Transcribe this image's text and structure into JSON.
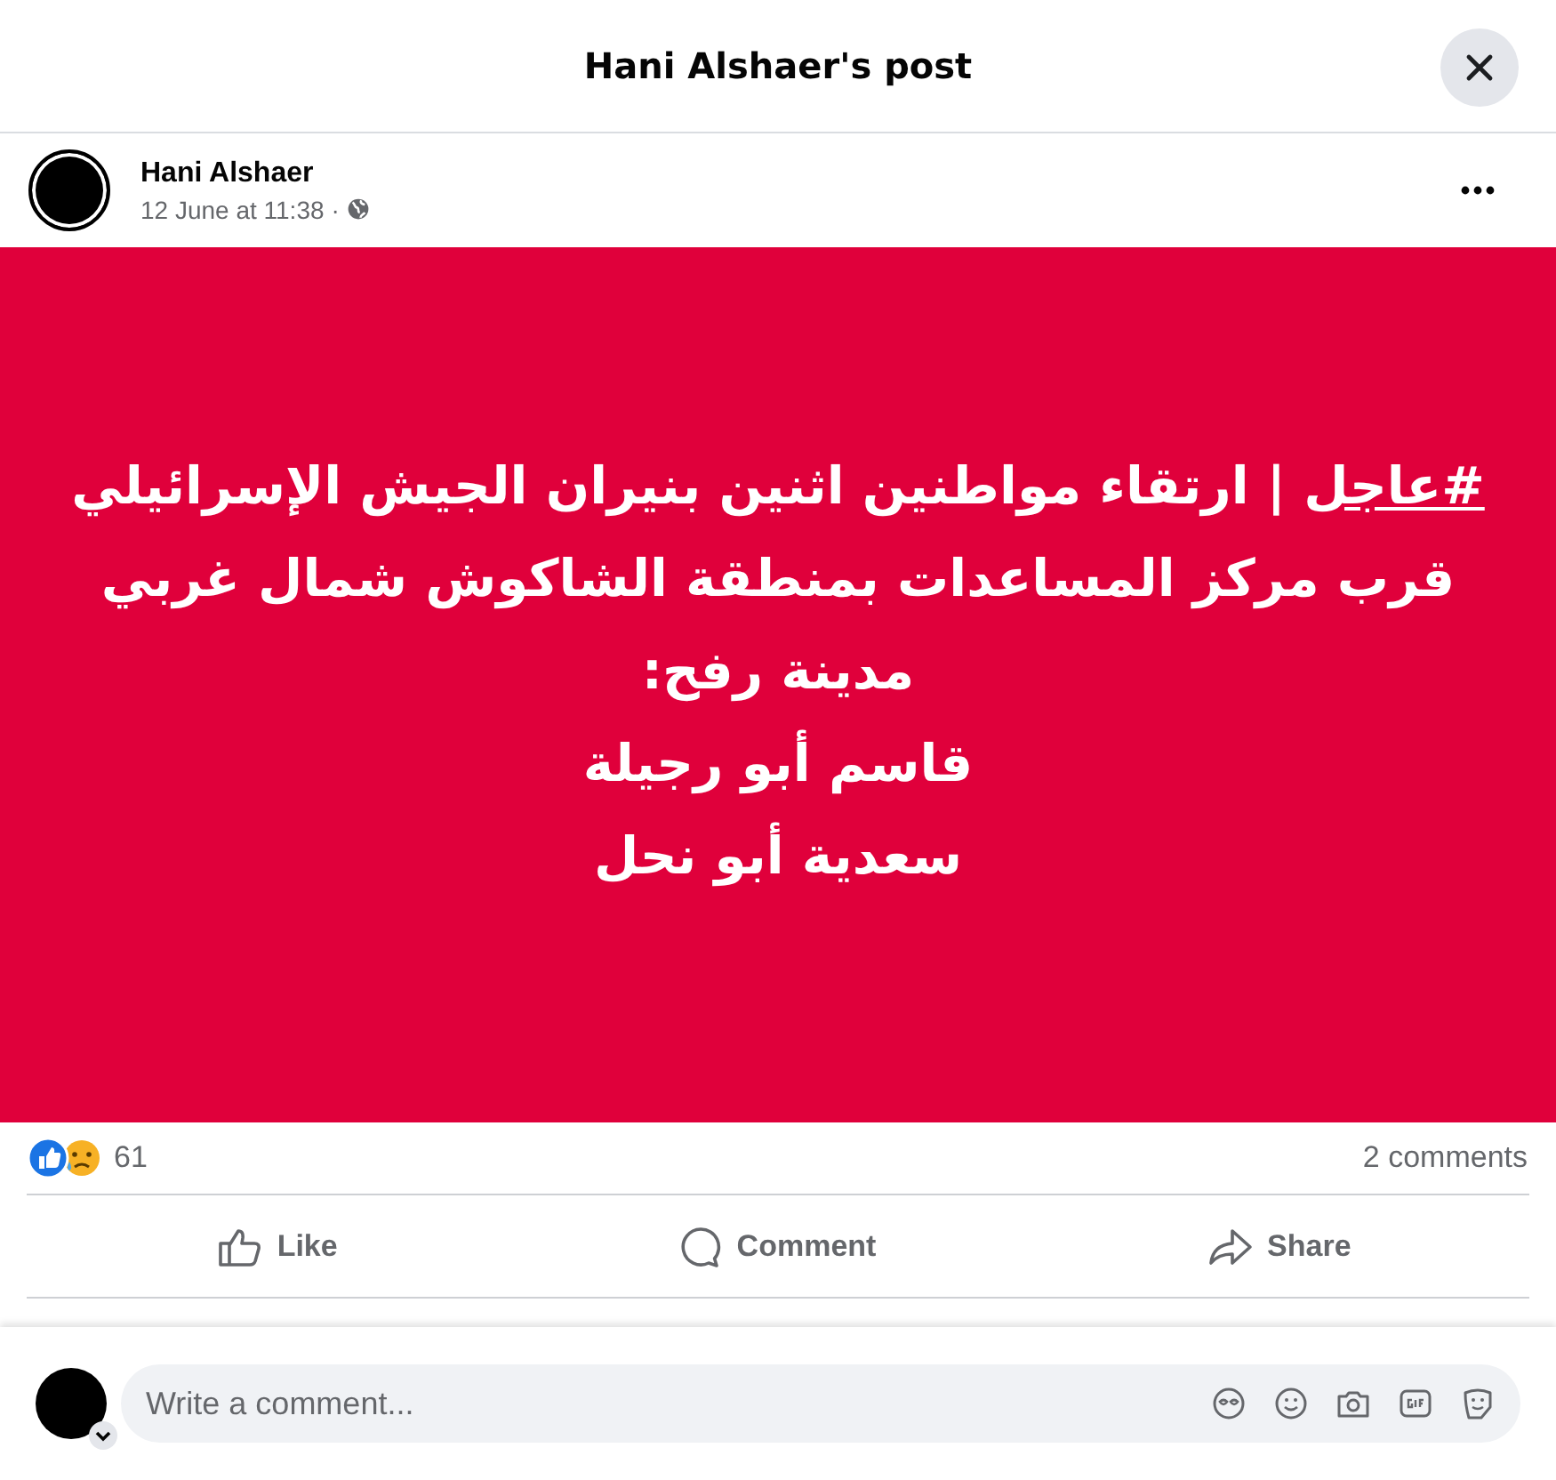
{
  "dialog": {
    "title": "Hani Alshaer's post"
  },
  "post": {
    "author": "Hani Alshaer",
    "time": "12 June at 11:38",
    "separator": "·",
    "hashtag": "#عاجل",
    "text": "| ارتقاء مواطنين اثنين بنيران الجيش الإسرائيلي قرب مركز المساعدات بمنطقة الشاكوش شمال غربي مدينة رفح:",
    "names": [
      "قاسم أبو رجيلة",
      "سعدية أبو نحل"
    ]
  },
  "reactions": {
    "count": "61",
    "comments": "2 comments"
  },
  "actions": {
    "like": "Like",
    "comment": "Comment",
    "share": "Share"
  },
  "composer": {
    "placeholder": "Write a comment..."
  }
}
